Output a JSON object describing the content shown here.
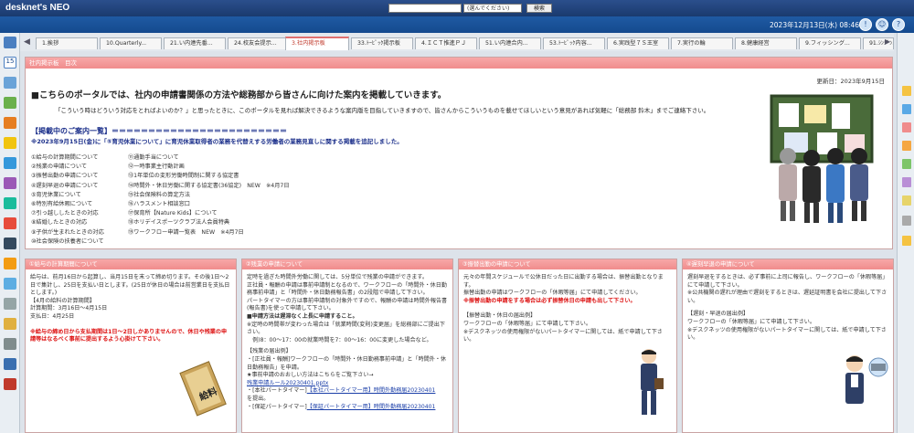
{
  "app": {
    "logo": "desknet's NEO",
    "datetime": "2023年12月13日(水) 08:46"
  },
  "search": {
    "select": "(選んでください)",
    "button": "検索"
  },
  "tabs": [
    "1.挨拶",
    "10.Quarterly...",
    "21.い内連先番...",
    "24.校友会提示...",
    "3.社内掲示板",
    "33.ﾄｰﾋﾟｯｸ掲示板",
    "4.ＩＣＴ推進ＰＪ",
    "51.い内連合内...",
    "53.ﾄｰﾋﾟｯｸ内容...",
    "6.実践型７Ｓ王室",
    "7.実行の輪",
    "8.健康経営",
    "9.フィッシング...",
    "91.ｼﾝｼﾞﾝ..."
  ],
  "main": {
    "header": "社内掲示板　目次",
    "updated": "更新日：2023年9月15日",
    "intro": "■こちらのポータルでは、社内の申請書関係の方法や総務部から皆さんに向けた案内を掲載していきます。",
    "intro2": "「こういう時はどういう対応をとればよいのか？」と思ったときに、このポータルを見れば解決できるような案内版を目指していきますので、皆さんからこういうものを載せてほしいという意見があれば気軽に「総務部 鈴木」までご連絡下さい。",
    "notice_title": "【掲載中のご案内一覧】＝＝＝＝＝＝＝＝＝＝＝＝＝＝＝＝＝＝＝＝＝＝＝＝",
    "notice_line": "※2023年9月15日(金)に「⑤育児休業について」に育児休業取得者の業務を代替えする労働者の業務見直しに関する掲載を追記しました。",
    "list_left": [
      "①給与の計算期間について",
      "②残業の申請について",
      "③振替出勤の申請について",
      "④遅刻早退の申請について",
      "⑤育児休業について",
      "⑥特別有給休暇について",
      "⑦引っ越ししたときの対応",
      "⑧結婚したときの対応",
      "⑨子供が生まれたときの対応",
      "⑩社会保険の扶養者について"
    ],
    "list_right": [
      "⑪通勤手当について",
      "⑫一時事業主行動計画",
      "⑬1年単位の変形労働時間制に関する協定書",
      "⑭時間外・休日労働に関する協定書(36協定)　NEW　※4月7日",
      "⑮社会保険料の算定方法",
      "⑯ハラスメント相談窓口",
      "⑰保育所【Nature Kids】について",
      "⑱ホリデイスポーツクラブ法人会員特典",
      "⑲ワークフロー申請一覧表　NEW　※4月7日"
    ]
  },
  "cards": [
    {
      "header": "①給与の計算期間について",
      "lines": [
        "給与は、前月16日から起算し、当月15日を末って締め切ります。その後1日〜2日で集計し、25日を支払い日とします。(25日が休日の場合は前営業日を支払日とします。)",
        "【4月の給料の計算期間】",
        "計算期間：3月16日〜4月15日",
        "支払日：4月25日"
      ],
      "warn": "※給与の締め日から支払期間は1日〜2日しかありませんので、休日や残業の申請等はなるべく事前に提出するよう心掛けて下さい。",
      "illus_label": "給料"
    },
    {
      "header": "②残業の申請について",
      "lines": [
        "定時を過ぎた時間外労働に関しては、5分単位で残業の申請ができます。",
        "正社員・報酬の申請は事前申請制となるので、ワークフローの「時間外・休日勤務事前申請」と「時間外・休日勤務報告書」の2段階で申請して下さい。",
        "パートタイマーの方は事前申請制の対象外ですので、報酬の申請は時間外報告書(報告書)を使って申請して下さい。"
      ],
      "bold": "■申請方法は遅滞なく上長に申請すること。",
      "lines2": [
        "※定時の時間帯が変わった場合は「就業時間(変則)変更届」を総務部にご提出下さい。",
        "　例)8：00〜17：00の就業時間を7：00〜16：00に変更した場合など。",
        "",
        "【残業の届出例】",
        "・[正社員・報酬]ワークフローの「時間外・休日勤務事前申請」と「時間外・休日勤務報告」を申請。",
        "★事前申請のおおしい方法はこちらをご覧下さい→"
      ],
      "link1": "残業申請ルール20230401.pptx",
      "line3": "・[本社パートタイマー]",
      "link2": "【本社パートタイマー用】時間外勤務届20230401",
      "line4": "を提出。",
      "line5": "・[保証パートタイマー]",
      "link3": "【保証パートタイマー用】時間外勤務届20230401"
    },
    {
      "header": "③振替出勤の申請について",
      "lines": [
        "元々の年間スケジュールで公休日だった日に出勤する場合は、振替出勤となります。",
        "振替出勤の申請はワークフローの「休暇等届」にて申請してください。"
      ],
      "bold": "※振替出勤の申請をする場合は必ず振替休日の申請も出して下さい。",
      "lines2": [
        "【振替出勤・休日の届出例】",
        "ワークフローの「休暇等届」にて申請して下さい。",
        "※デスクネッツの使用権限がないパートタイマーに関しては、紙で申請して下さい。"
      ]
    },
    {
      "header": "④遅刻早退の申請について",
      "lines": [
        "遅刻早退をするときは、必ず事前に上司に報告し、ワークフローの「休暇等届」にて申請して下さい。",
        "※公共機関の遅れが理由で遅刻をするときは、遅延証明書を会社に提出して下さい。",
        "",
        "【遅刻・早退の届出例】",
        "ワークフローの「休暇等届」にて申請して下さい。",
        "※デスクネッツの使用権限がないパートタイマーに関しては、紙で申請して下さい。"
      ]
    }
  ],
  "colors": {
    "accent": "#f08c8c",
    "header": "#1f5aa3",
    "link": "#1a3ea8",
    "warn": "#dd1111"
  }
}
